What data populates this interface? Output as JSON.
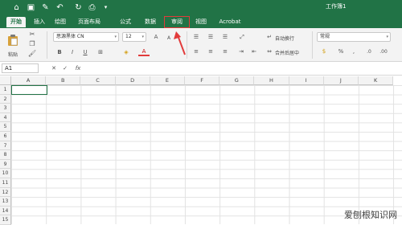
{
  "window": {
    "title": "工作簿1"
  },
  "quick_access": [
    "home-icon",
    "save-icon",
    "edit-icon",
    "undo-icon",
    "redo-icon",
    "print-icon",
    "more-icon"
  ],
  "tabs": [
    {
      "label": "开始",
      "active": true
    },
    {
      "label": "插入"
    },
    {
      "label": "绘图"
    },
    {
      "label": "页面布局"
    },
    {
      "label": "公式"
    },
    {
      "label": "数据"
    },
    {
      "label": "审阅",
      "highlighted": true
    },
    {
      "label": "视图"
    },
    {
      "label": "Acrobat"
    }
  ],
  "ribbon": {
    "paste_label": "粘贴",
    "font_name": "思源黑体 CN",
    "font_size": "12",
    "wrap_text_label": "自动换行",
    "merge_center_label": "合并后居中",
    "number_format": "常规",
    "bold": "B",
    "italic": "I",
    "underline": "U",
    "grow_font": "A",
    "shrink_font": "A",
    "font_color": "A",
    "percent": "%"
  },
  "formula_bar": {
    "name_box": "A1",
    "fx": "fx"
  },
  "columns": [
    "A",
    "B",
    "C",
    "D",
    "E",
    "F",
    "G",
    "H",
    "I",
    "J",
    "K"
  ],
  "rows": [
    "1",
    "2",
    "3",
    "4",
    "5",
    "6",
    "7",
    "8",
    "9",
    "10",
    "11",
    "12",
    "13",
    "14",
    "15"
  ],
  "watermark": "爱刨根知识网",
  "colors": {
    "accent": "#217346",
    "highlight": "#e23b3b"
  }
}
